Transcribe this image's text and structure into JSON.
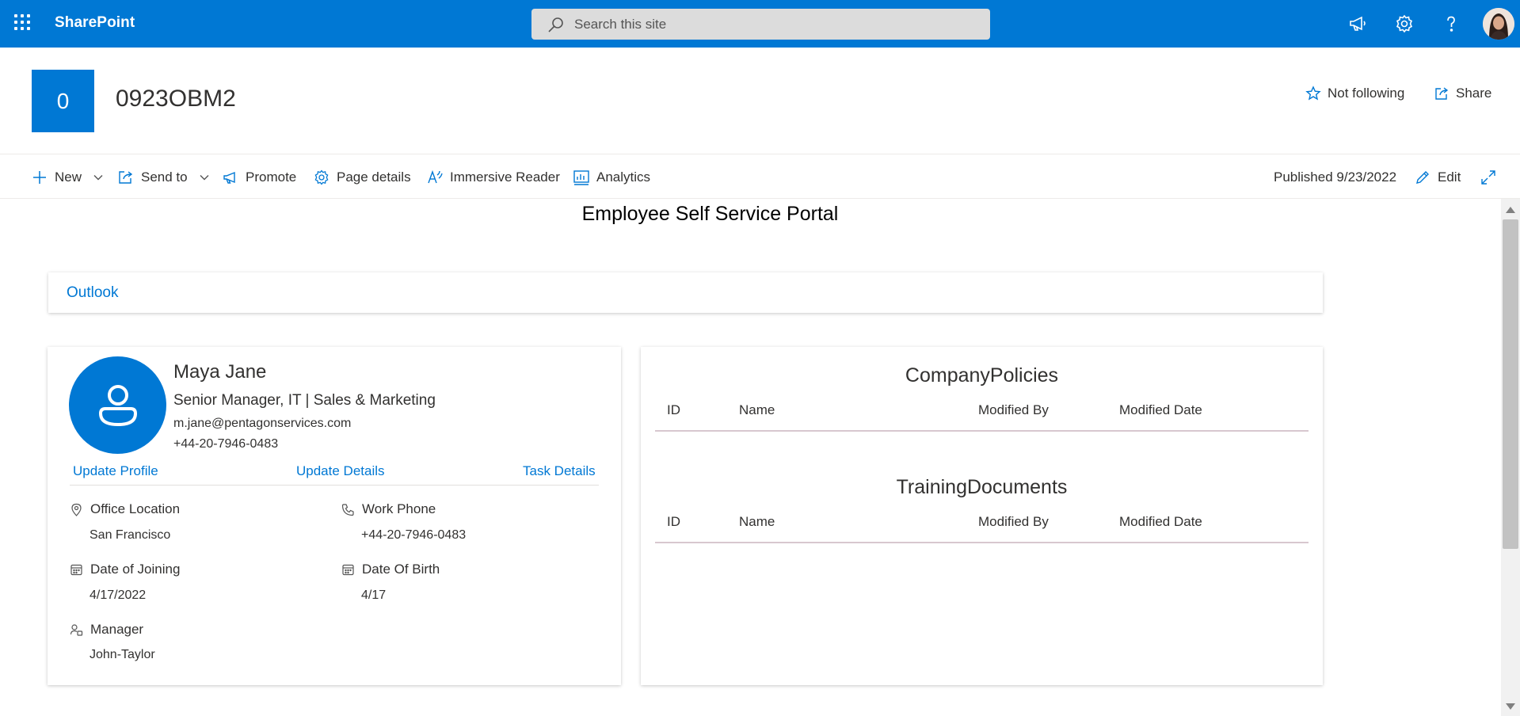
{
  "suitebar": {
    "app_name": "SharePoint",
    "search_placeholder": "Search this site",
    "icons": [
      "waffle-icon",
      "megaphone-icon",
      "settings-icon",
      "help-icon",
      "user-avatar"
    ]
  },
  "site": {
    "logo_letter": "0",
    "title": "0923OBM2",
    "follow_label": "Not following",
    "share_label": "Share"
  },
  "commandbar": {
    "new_label": "New",
    "send_to_label": "Send to",
    "promote_label": "Promote",
    "page_details_label": "Page details",
    "immersive_reader_label": "Immersive Reader",
    "analytics_label": "Analytics",
    "published": "Published 9/23/2022",
    "edit_label": "Edit"
  },
  "page": {
    "heading": "Employee Self Service Portal",
    "outlook_link": "Outlook"
  },
  "profile": {
    "name": "Maya Jane",
    "title": "Senior Manager, IT | Sales & Marketing",
    "email": "m.jane@pentagonservices.com",
    "phone": "+44-20-7946-0483",
    "links": {
      "update_profile": "Update Profile",
      "update_details": "Update Details",
      "task_details": "Task Details"
    },
    "fields": {
      "office_location": {
        "label": "Office Location",
        "value": "San Francisco"
      },
      "work_phone": {
        "label": "Work Phone",
        "value": "+44-20-7946-0483"
      },
      "date_of_joining": {
        "label": "Date of Joining",
        "value": "4/17/2022"
      },
      "date_of_birth": {
        "label": "Date Of Birth",
        "value": "4/17"
      },
      "manager": {
        "label": "Manager",
        "value": "John-Taylor"
      }
    }
  },
  "documents": {
    "columns": [
      "ID",
      "Name",
      "Modified By",
      "Modified Date"
    ],
    "company_policies": {
      "title": "CompanyPolicies",
      "rows": []
    },
    "training_documents": {
      "title": "TrainingDocuments",
      "rows": []
    }
  },
  "colors": {
    "brand": "#0078d4",
    "text": "#323130",
    "search_bg": "#dcdcdc"
  }
}
